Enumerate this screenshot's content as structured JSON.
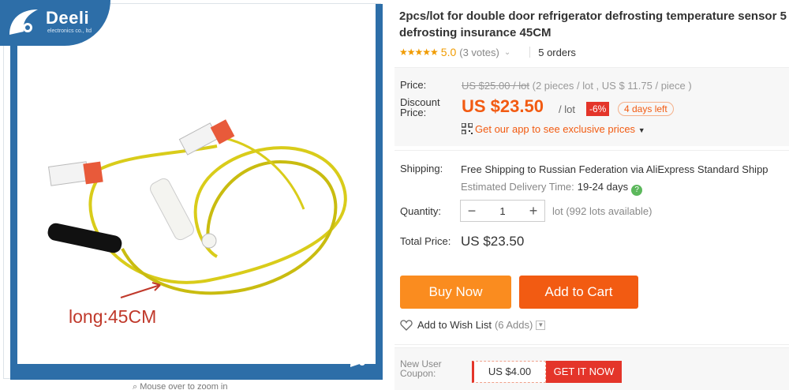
{
  "image": {
    "brand_name": "Deeli",
    "brand_sub": "electronics co., ltd",
    "length_label": "long:45CM",
    "zoom_hint": "Mouse over to zoom in"
  },
  "product": {
    "title_line1": "2pcs/lot for double door refrigerator defrosting temperature sensor 5",
    "title_line2": "defrosting insurance 45CM",
    "stars": "★★★★★",
    "score": "5.0",
    "votes": "(3 votes)",
    "orders": "5 orders"
  },
  "price": {
    "price_label": "Price:",
    "original": "US $25.00 / lot",
    "original_detail": "(2 pieces / lot , US $ 11.75 / piece )",
    "discount_label_1": "Discount",
    "discount_label_2": "Price:",
    "discount_price": "US $23.50",
    "per_lot": "/ lot",
    "discount_badge": "-6%",
    "days_left": "4 days left",
    "app_link": "Get our app to see exclusive prices"
  },
  "shipping": {
    "label": "Shipping:",
    "free": "Free Shipping to",
    "destination": "Russian Federation via AliExpress Standard Shipp",
    "est_label": "Estimated Delivery Time:",
    "est_value": "19-24 days"
  },
  "quantity": {
    "label": "Quantity:",
    "value": "1",
    "note": "lot (992 lots available)"
  },
  "total": {
    "label": "Total Price:",
    "value": "US $23.50"
  },
  "actions": {
    "buy": "Buy Now",
    "cart": "Add to Cart",
    "wish": "Add to Wish List",
    "wish_count": "(6 Adds)"
  },
  "coupon": {
    "label_1": "New User",
    "label_2": "Coupon:",
    "value": "US $4.00",
    "button": "GET IT NOW"
  },
  "colors": {
    "accent": "#f25b12",
    "buy": "#fa8c1f",
    "brand_blue": "#2d6ea8",
    "star": "#f09b00"
  }
}
